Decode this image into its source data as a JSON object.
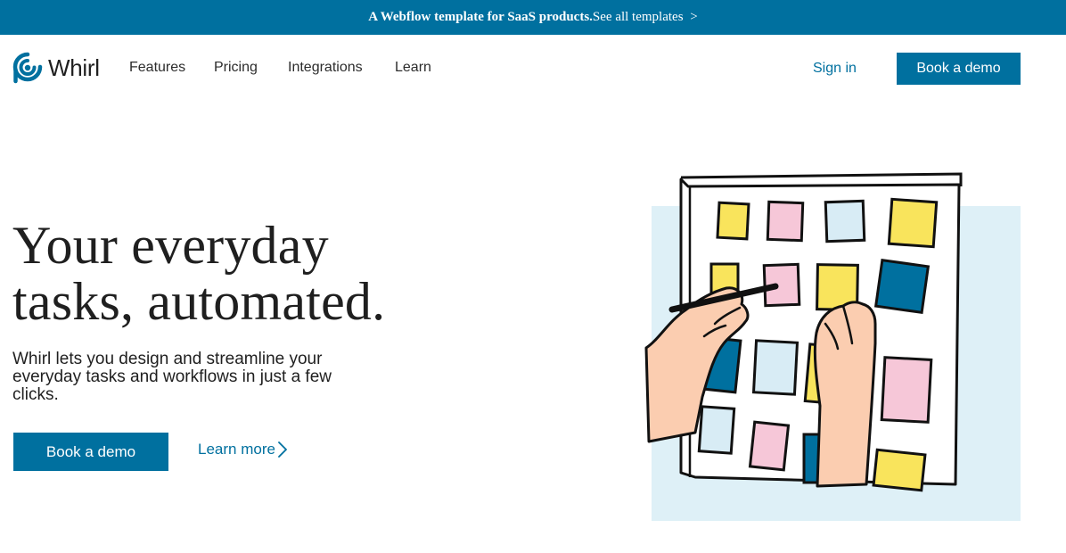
{
  "banner": {
    "text": "A Webflow template for SaaS products.",
    "link": "See all templates",
    "chevron": ">"
  },
  "brand": {
    "name": "Whirl",
    "logo_icon": "whirl-logo-icon",
    "color": "#00709f"
  },
  "nav": {
    "links": [
      "Features",
      "Pricing",
      "Integrations",
      "Learn"
    ],
    "sign_in": "Sign in",
    "cta": "Book a demo"
  },
  "hero": {
    "title_line1": "Your everyday",
    "title_line2": "tasks, automated.",
    "subtitle": "Whirl lets you design and streamline your everyday tasks and workflows in just a few clicks.",
    "primary_cta": "Book a demo",
    "secondary_cta": "Learn more",
    "secondary_icon": "chevron-right-icon"
  },
  "illustration": {
    "description_icon": "sticky-notes-board-illustration",
    "colors": {
      "yellow": "#f9e45c",
      "pink": "#f6c7d8",
      "light_blue": "#d8ecf5",
      "dark_blue": "#00709f",
      "skin": "#fbcdb0",
      "backdrop": "#def0f7"
    }
  }
}
